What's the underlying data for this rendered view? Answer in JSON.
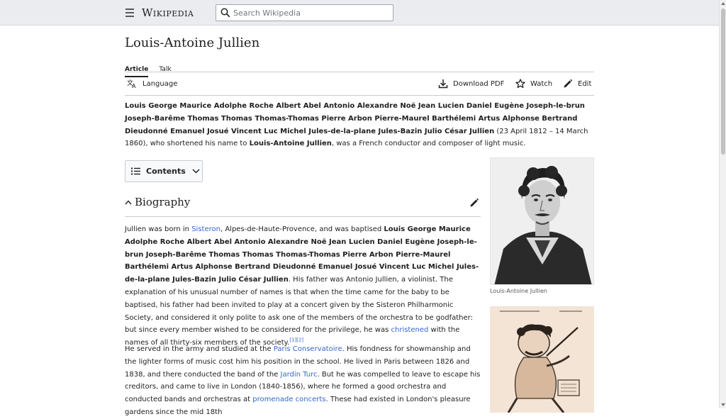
{
  "header": {
    "wordmark": "Wikipedia",
    "search_placeholder": "Search Wikipedia"
  },
  "article": {
    "title": "Louis-Antoine Jullien",
    "tabs": [
      {
        "label": "Article",
        "active": true
      },
      {
        "label": "Talk",
        "active": false
      }
    ]
  },
  "toolbar": {
    "language": "Language",
    "download_pdf": "Download PDF",
    "watch": "Watch",
    "edit": "Edit"
  },
  "lead": {
    "bold_name": "Louis George Maurice Adolphe Roche Albert Abel Antonio Alexandre Noë Jean Lucien Daniel Eugène Joseph-le-brun Joseph-Barême Thomas Thomas Thomas-Thomas Pierre Arbon Pierre-Maurel Barthélemi Artus Alphonse Bertrand Dieudonné Emanuel Josué Vincent Luc Michel Jules-de-la-plane Jules-Bazin Julio César Jullien",
    "text_1": " (23 April 1812 – 14 March 1860), who shortened his name to ",
    "bold_short": "Louis-Antoine Jullien",
    "text_2": ", was a French conductor and composer of light music."
  },
  "contents": {
    "label": "Contents"
  },
  "biography": {
    "heading": "Biography",
    "p1": {
      "t1": "Jullien was born in ",
      "link_sisteron": "Sisteron",
      "t2": ", Alpes-de-Haute-Provence, and was baptised ",
      "bold_name": "Louis George Maurice Adolphe Roche Albert Abel Antonio Alexandre Noë Jean Lucien Daniel Eugène Joseph-le-brun Joseph-Barême Thomas Thomas Thomas-Thomas Pierre Arbon Pierre-Maurel Barthélemi Artus Alphonse Bertrand Dieudonné Emanuel Josué Vincent Luc Michel Jules-de-la-plane Jules-Bazin Julio César Jullien",
      "t3": ". His father was Antonio Jullien, a violinist. The explanation of his unusual number of names is that when the time came for the baby to be baptised, his father had been invited to play at a concert given by the Sisteron Philharmonic Society, and considered it only polite to ask one of the members of the orchestra to be godfather: but since every member wished to be considered for the privilege, he was ",
      "link_christened": "christened",
      "t4": " with the names of all thirty-six members of the society.",
      "refs": "[1][2]"
    },
    "p2": {
      "t1": "He served in the army and studied at the ",
      "link_conservatoire": "Paris Conservatoire",
      "t2": ". His fondness for showmanship and the lighter forms of music cost him his position in the school. He lived in Paris between 1826 and 1838, and there conducted the band of the ",
      "link_jardin": "Jardin Turc",
      "t3": ". But he was compelled to leave to escape his creditors, and came to live in London (1840-1856), where he formed a good orchestra and conducted bands and orchestras at ",
      "link_promenade": "promenade concerts",
      "t4": ". These had existed in London's pleasure gardens since the mid 18th"
    }
  },
  "infobox": {
    "portrait_caption": "Louis-Antoine Jullien"
  },
  "colors": {
    "link": "#3366cc",
    "header_bg": "#eaecf0",
    "text": "#202122"
  }
}
